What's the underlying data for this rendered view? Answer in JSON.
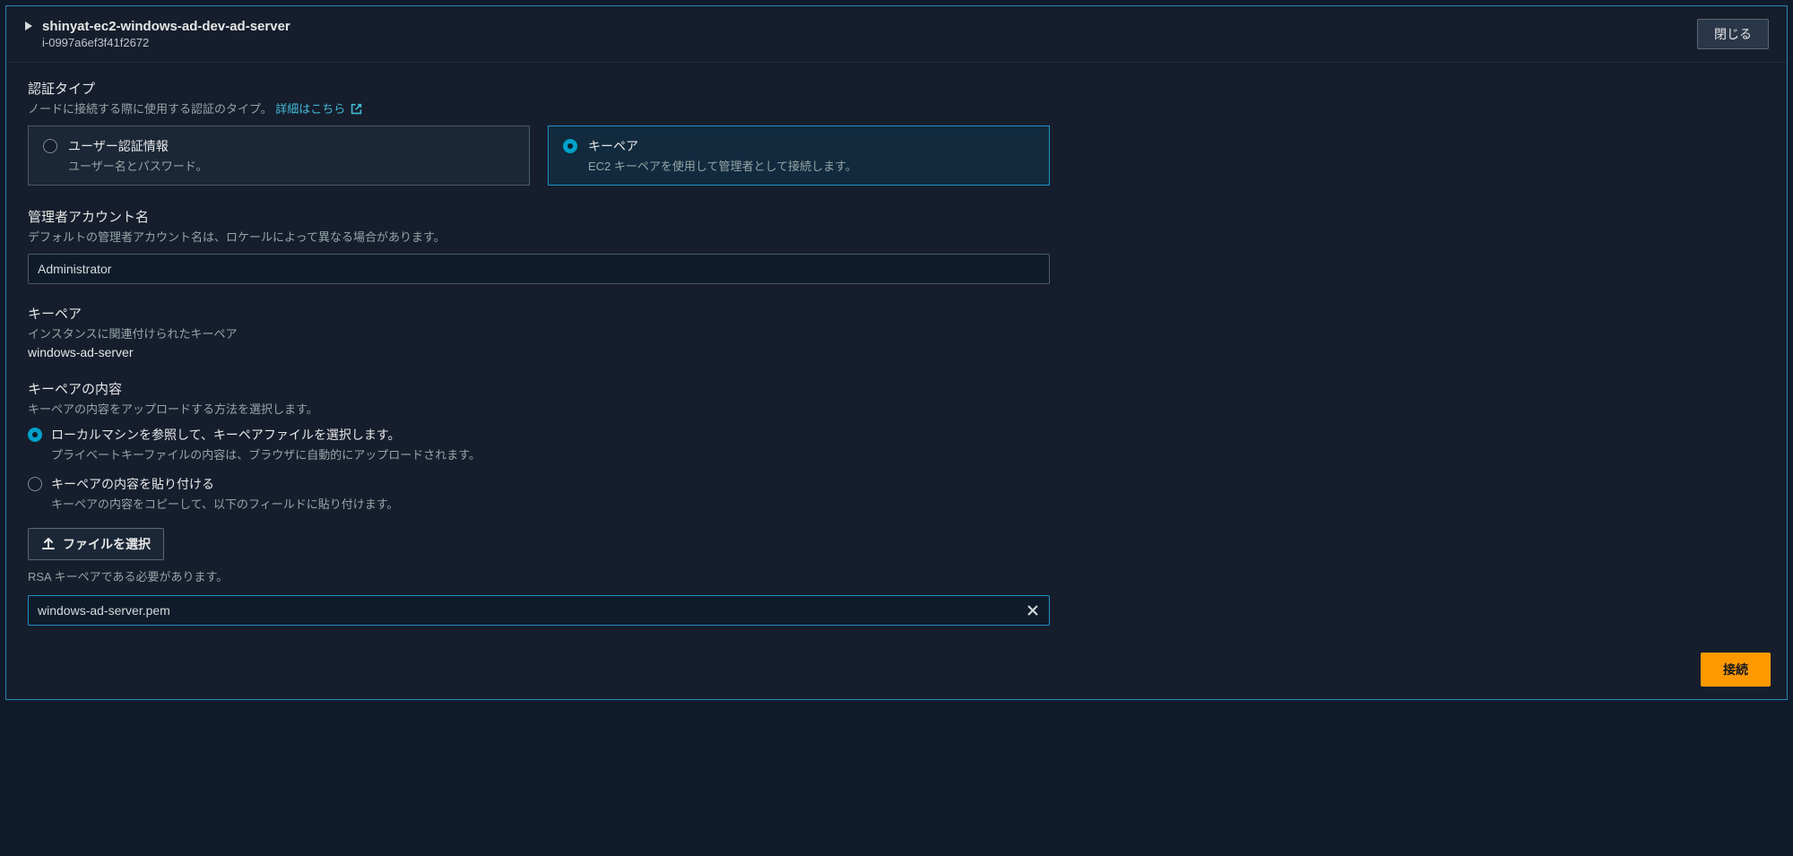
{
  "header": {
    "instance_name": "shinyat-ec2-windows-ad-dev-ad-server",
    "instance_id": "i-0997a6ef3f41f2672",
    "close_label": "閉じる"
  },
  "auth_type": {
    "label": "認証タイプ",
    "description": "ノードに接続する際に使用する認証のタイプ。",
    "learn_more": "詳細はこちら",
    "options": [
      {
        "title": "ユーザー認証情報",
        "desc": "ユーザー名とパスワード。",
        "selected": false
      },
      {
        "title": "キーペア",
        "desc": "EC2 キーペアを使用して管理者として接続します。",
        "selected": true
      }
    ]
  },
  "admin_account": {
    "label": "管理者アカウント名",
    "description": "デフォルトの管理者アカウント名は、ロケールによって異なる場合があります。",
    "value": "Administrator"
  },
  "keypair": {
    "label": "キーペア",
    "description": "インスタンスに関連付けられたキーペア",
    "value": "windows-ad-server"
  },
  "keypair_content": {
    "label": "キーペアの内容",
    "description": "キーペアの内容をアップロードする方法を選択します。",
    "options": [
      {
        "title": "ローカルマシンを参照して、キーペアファイルを選択します。",
        "desc": "プライベートキーファイルの内容は、ブラウザに自動的にアップロードされます。",
        "selected": true
      },
      {
        "title": "キーペアの内容を貼り付ける",
        "desc": "キーペアの内容をコピーして、以下のフィールドに貼り付けます。",
        "selected": false
      }
    ],
    "choose_file_label": "ファイルを選択",
    "helper": "RSA キーペアである必要があります。",
    "file_value": "windows-ad-server.pem"
  },
  "footer": {
    "connect_label": "接続"
  }
}
